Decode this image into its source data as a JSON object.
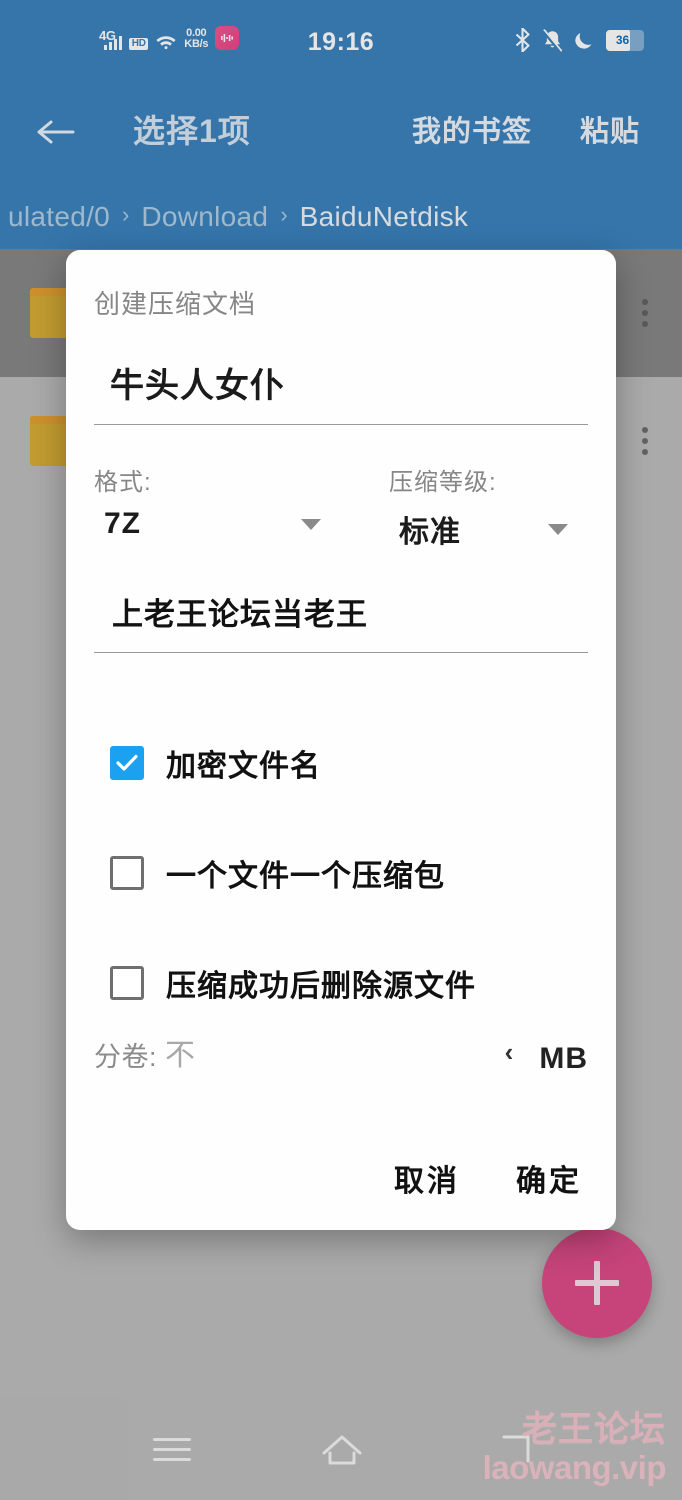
{
  "status_bar": {
    "network_type": "4G",
    "hd_label": "HD",
    "data_rate": "0.00",
    "data_rate_unit": "KB/s",
    "clock": "19:16",
    "battery_percent": "36",
    "icons": [
      "signal-bars-icon",
      "hd-icon",
      "wifi-icon",
      "app-notification-icon",
      "bluetooth-icon",
      "bell-muted-icon",
      "moon-dnd-icon",
      "battery-icon"
    ]
  },
  "app_bar": {
    "back_label": "←",
    "title": "选择1项",
    "action_bookmark": "我的书签",
    "action_paste": "粘贴"
  },
  "breadcrumb": {
    "separator": "›",
    "items": [
      {
        "label": "ulated/0",
        "active": false
      },
      {
        "label": "Download",
        "active": false
      },
      {
        "label": "BaiduNetdisk",
        "active": true
      }
    ]
  },
  "file_list": {
    "rows": [
      {
        "state": "selected",
        "icon": "folder-icon"
      },
      {
        "state": "normal",
        "icon": "folder-icon"
      }
    ],
    "overflow_icon": "more-vertical-icon"
  },
  "fab": {
    "icon": "plus-icon",
    "color": "#d4216b"
  },
  "bottom_nav": {
    "recent_icon": "recents-hamburger-icon",
    "home_icon": "home-icon",
    "back_icon": "back-icon"
  },
  "watermark": {
    "line1": "老王论坛",
    "line2": "laowang.vip",
    "color": "#f2b5c1"
  },
  "dialog": {
    "title": "创建压缩文档",
    "archive_name": {
      "value": "牛头人女仆",
      "placeholder": ""
    },
    "format": {
      "label": "格式:",
      "value": "7Z",
      "dropdown_icon": "chevron-down-icon"
    },
    "compression_level": {
      "label": "压缩等级:",
      "value": "标准",
      "dropdown_icon": "chevron-down-icon"
    },
    "password": {
      "value": "上老王论坛当老王",
      "placeholder": ""
    },
    "checkboxes": [
      {
        "label": "加密文件名",
        "checked": true
      },
      {
        "label": "一个文件一个压缩包",
        "checked": false
      },
      {
        "label": "压缩成功后删除源文件",
        "checked": false
      }
    ],
    "split_volume": {
      "label": "分卷:",
      "placeholder": "不",
      "value": "",
      "stepper_icon": "chevron-left-icon",
      "unit": "MB"
    },
    "buttons": {
      "cancel": "取消",
      "confirm": "确定"
    },
    "accent_checkbox_color": "#1ca0f0"
  },
  "theme": {
    "app_bar_blue": "#0c64ad",
    "background_grey": "#adadad",
    "selected_row_grey": "#6a6a6a",
    "folder_orange": "#cf9a05"
  }
}
